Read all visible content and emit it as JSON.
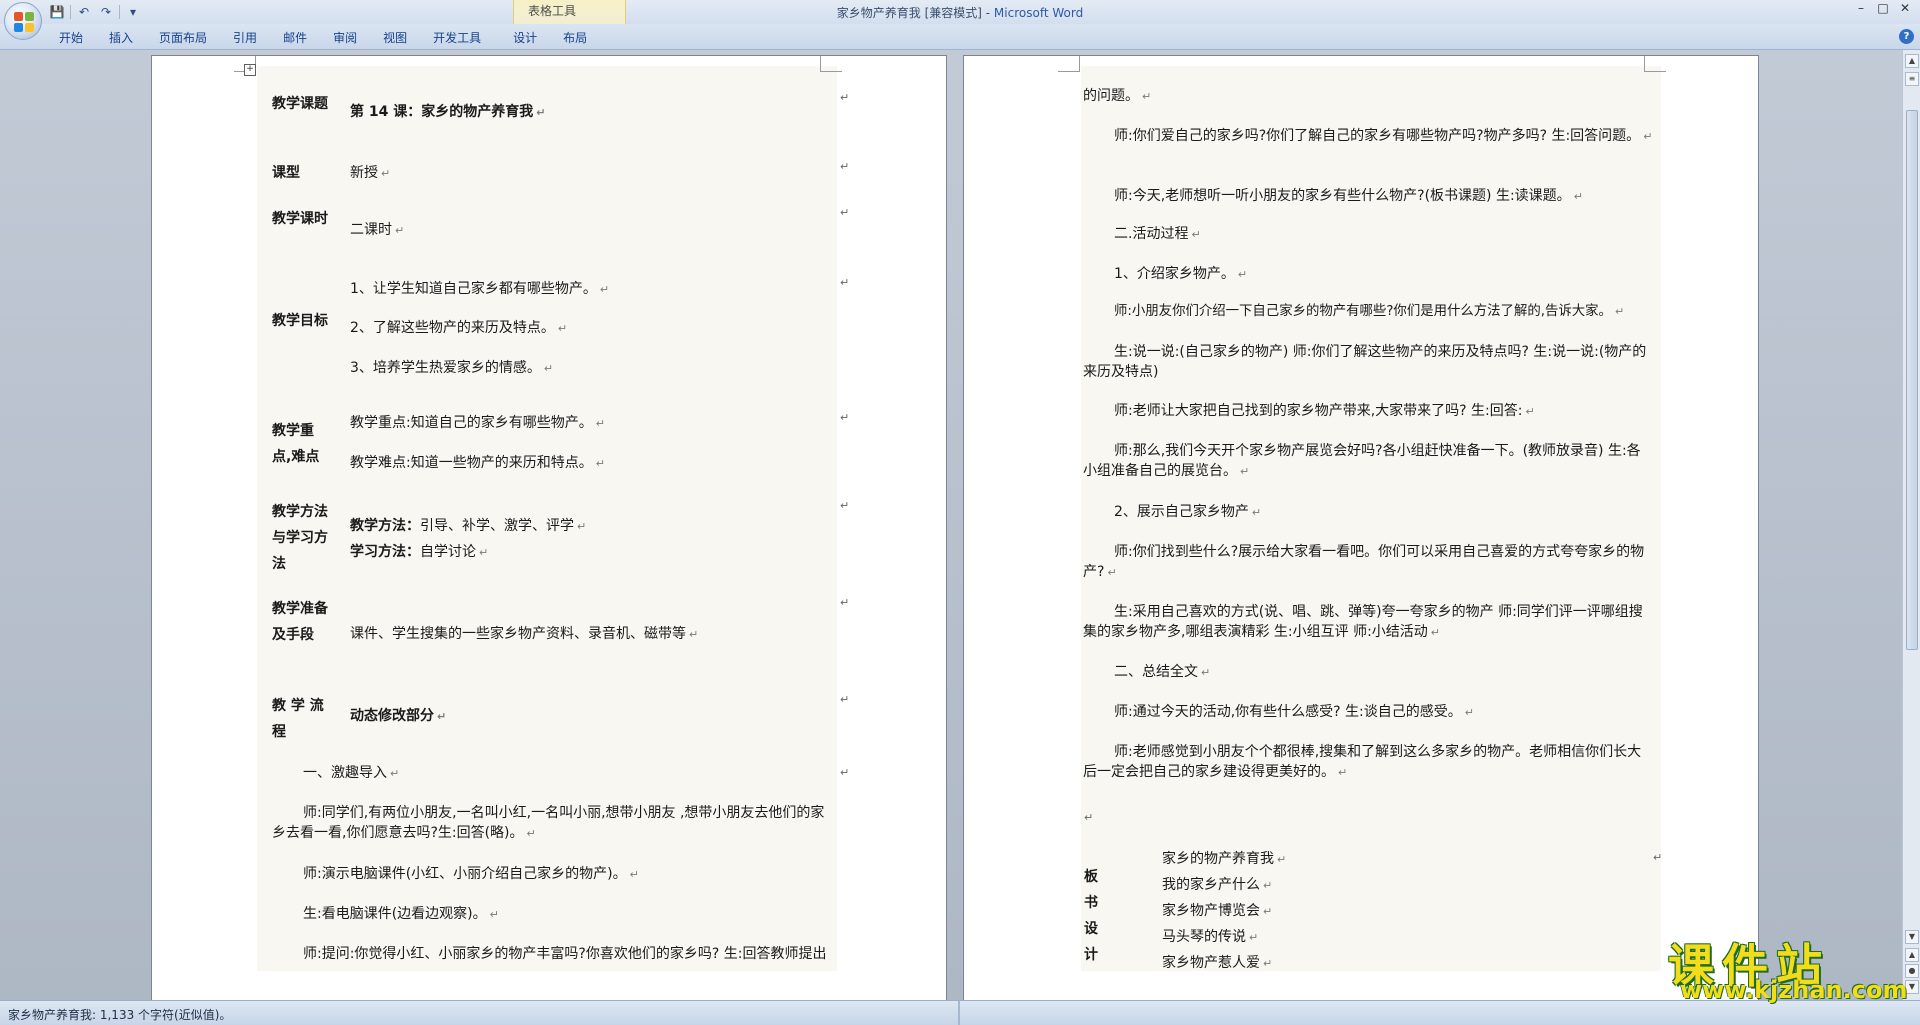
{
  "window": {
    "title": "家乡物产养育我 [兼容模式] - ",
    "app_name": "Microsoft Word",
    "context_tab_group": "表格工具",
    "controls": [
      "–",
      "□",
      "✕"
    ]
  },
  "qat": {
    "save": "💾",
    "undo": "↶",
    "redo": "↷",
    "more": "▾"
  },
  "ribbon": {
    "tabs": [
      "开始",
      "插入",
      "页面布局",
      "引用",
      "邮件",
      "审阅",
      "视图",
      "开发工具",
      "设计",
      "布局"
    ],
    "help": "?"
  },
  "left_page": {
    "move_handle": "+",
    "rows": [
      {
        "label": "教学课题",
        "content": "第 14 课：家乡的物产养育我"
      },
      {
        "label": "课型",
        "content": "新授"
      },
      {
        "label": "教学课时",
        "content": "二课时"
      },
      {
        "label": "教学目标",
        "items": [
          "1、让学生知道自己家乡都有哪些物产。",
          "2、了解这些物产的来历及特点。",
          "3、培养学生热爱家乡的情感。"
        ]
      },
      {
        "label": "教学重点,难点",
        "items": [
          "教学重点:知道自己的家乡有哪些物产。",
          "教学难点:知道一些物产的来历和特点。"
        ]
      },
      {
        "label": "教学方法与学习方法",
        "method_label": "教学方法：",
        "method_value": "引导、补学、激学、评学",
        "study_label": "学习方法：",
        "study_value": "自学讨论"
      },
      {
        "label": "教学准备及手段",
        "content": "课件、学生搜集的一些家乡物产资料、录音机、磁带等"
      },
      {
        "label": "教 学 流 程",
        "content": "动态修改部分"
      }
    ],
    "body": [
      "一、激趣导入",
      "师:同学们,有两位小朋友,一名叫小红,一名叫小丽,想带小朋友 ,想带小朋友去他们的家乡去看一看,你们愿意去吗?生:回答(略)。",
      "师:演示电脑课件(小红、小丽介绍自己家乡的物产)。",
      "生:看电脑课件(边看边观察)。",
      "师:提问:你觉得小红、小丽家乡的物产丰富吗?你喜欢他们的家乡吗? 生:回答教师提出"
    ]
  },
  "right_page": {
    "body": [
      "的问题。",
      "师:你们爱自己的家乡吗?你们了解自己的家乡有哪些物产吗?物产多吗? 生:回答问题。",
      "师:今天,老师想听一听小朋友的家乡有些什么物产?(板书课题) 生:读课题。",
      "二.活动过程",
      "1、介绍家乡物产。",
      "师:小朋友你们介绍一下自己家乡的物产有哪些?你们是用什么方法了解的,告诉大家。",
      "生:说一说:(自己家乡的物产) 师:你们了解这些物产的来历及特点吗? 生:说一说:(物产的来历及特点)",
      "师:老师让大家把自己找到的家乡物产带来,大家带来了吗? 生:回答:",
      "师:那么,我们今天开个家乡物产展览会好吗?各小组赶快准备一下。(教师放录音) 生:各小组准备自己的展览台。",
      "2、展示自己家乡物产",
      "师:你们找到些什么?展示给大家看一看吧。你们可以采用自己喜爱的方式夸夸家乡的物产?",
      "生:采用自己喜欢的方式(说、唱、跳、弹等)夸一夸家乡的物产  师:同学们评一评哪组搜集的家乡物产多,哪组表演精彩 生:小组互评  师:小结活动",
      "二、总结全文",
      "师:通过今天的活动,你有些什么感受? 生:谈自己的感受。",
      "师:老师感觉到小朋友个个都很棒,搜集和了解到这么多家乡的物产。老师相信你们长大后一定会把自己的家乡建设得更美好的。"
    ],
    "board": {
      "label": "板书设计",
      "lines": [
        "家乡的物产养育我",
        "我的家乡产什么",
        "家乡物产博览会",
        "马头琴的传说",
        "家乡物产惹人爱"
      ]
    }
  },
  "status": {
    "text": "家乡物产养育我: 1,133 个字符(近似值)。"
  },
  "watermark": {
    "main": "课件站",
    "url": "www.kjzhan.com"
  },
  "colors": {
    "ribbon_text": "#15428b",
    "page_shade": "#f8f7f2",
    "watermark_fill": "#f3dd1b",
    "watermark_outline": "#1d6b25"
  }
}
